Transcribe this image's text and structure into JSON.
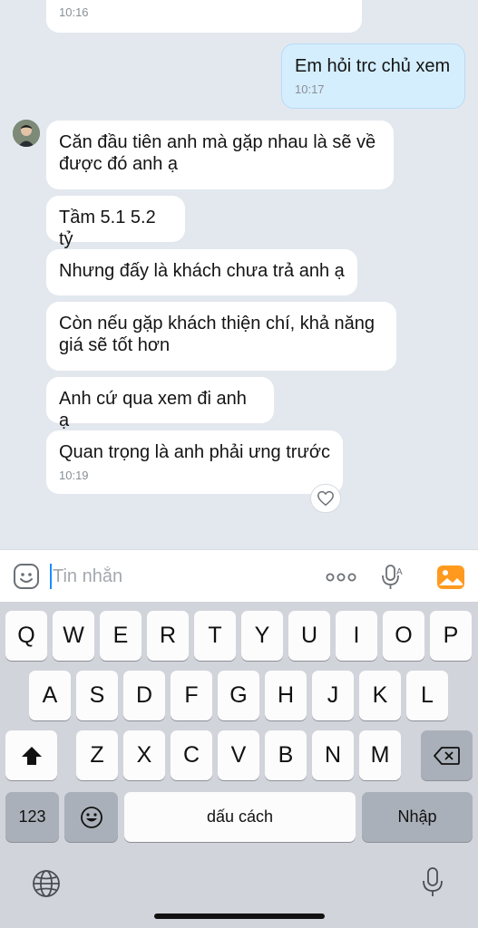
{
  "messages": [
    {
      "text": "",
      "time": "10:16"
    },
    {
      "text": "Em hỏi trc chủ xem",
      "time": "10:17"
    },
    {
      "text": "Căn đầu tiên anh mà gặp nhau là sẽ về được đó anh ạ"
    },
    {
      "text": "Tầm 5.1 5.2 tỷ"
    },
    {
      "text": "Nhưng đấy là khách chưa trả anh ạ"
    },
    {
      "text": "Còn nếu gặp khách thiện chí, khả năng giá sẽ tốt hơn"
    },
    {
      "text": "Anh cứ qua xem đi anh ạ"
    },
    {
      "text": "Quan trọng là anh phải ưng trước",
      "time": "10:19"
    }
  ],
  "input": {
    "placeholder": "Tin nhắn",
    "value": ""
  },
  "icons": {
    "emoji": "sticker-face-icon",
    "more": "more-dots-icon",
    "voice": "voice-to-text-icon",
    "image": "image-gallery-icon",
    "react": "heart-icon"
  },
  "keyboard": {
    "row1": [
      "Q",
      "W",
      "E",
      "R",
      "T",
      "Y",
      "U",
      "I",
      "O",
      "P"
    ],
    "row2": [
      "A",
      "S",
      "D",
      "F",
      "G",
      "H",
      "J",
      "K",
      "L"
    ],
    "row3": [
      "Z",
      "X",
      "C",
      "V",
      "B",
      "N",
      "M"
    ],
    "numbers": "123",
    "space": "dấu cách",
    "return": "Nhập"
  },
  "colors": {
    "accent": "#1a8cff",
    "outgoing_bubble": "#d5eefe",
    "chat_bg": "#e3e8ef"
  }
}
